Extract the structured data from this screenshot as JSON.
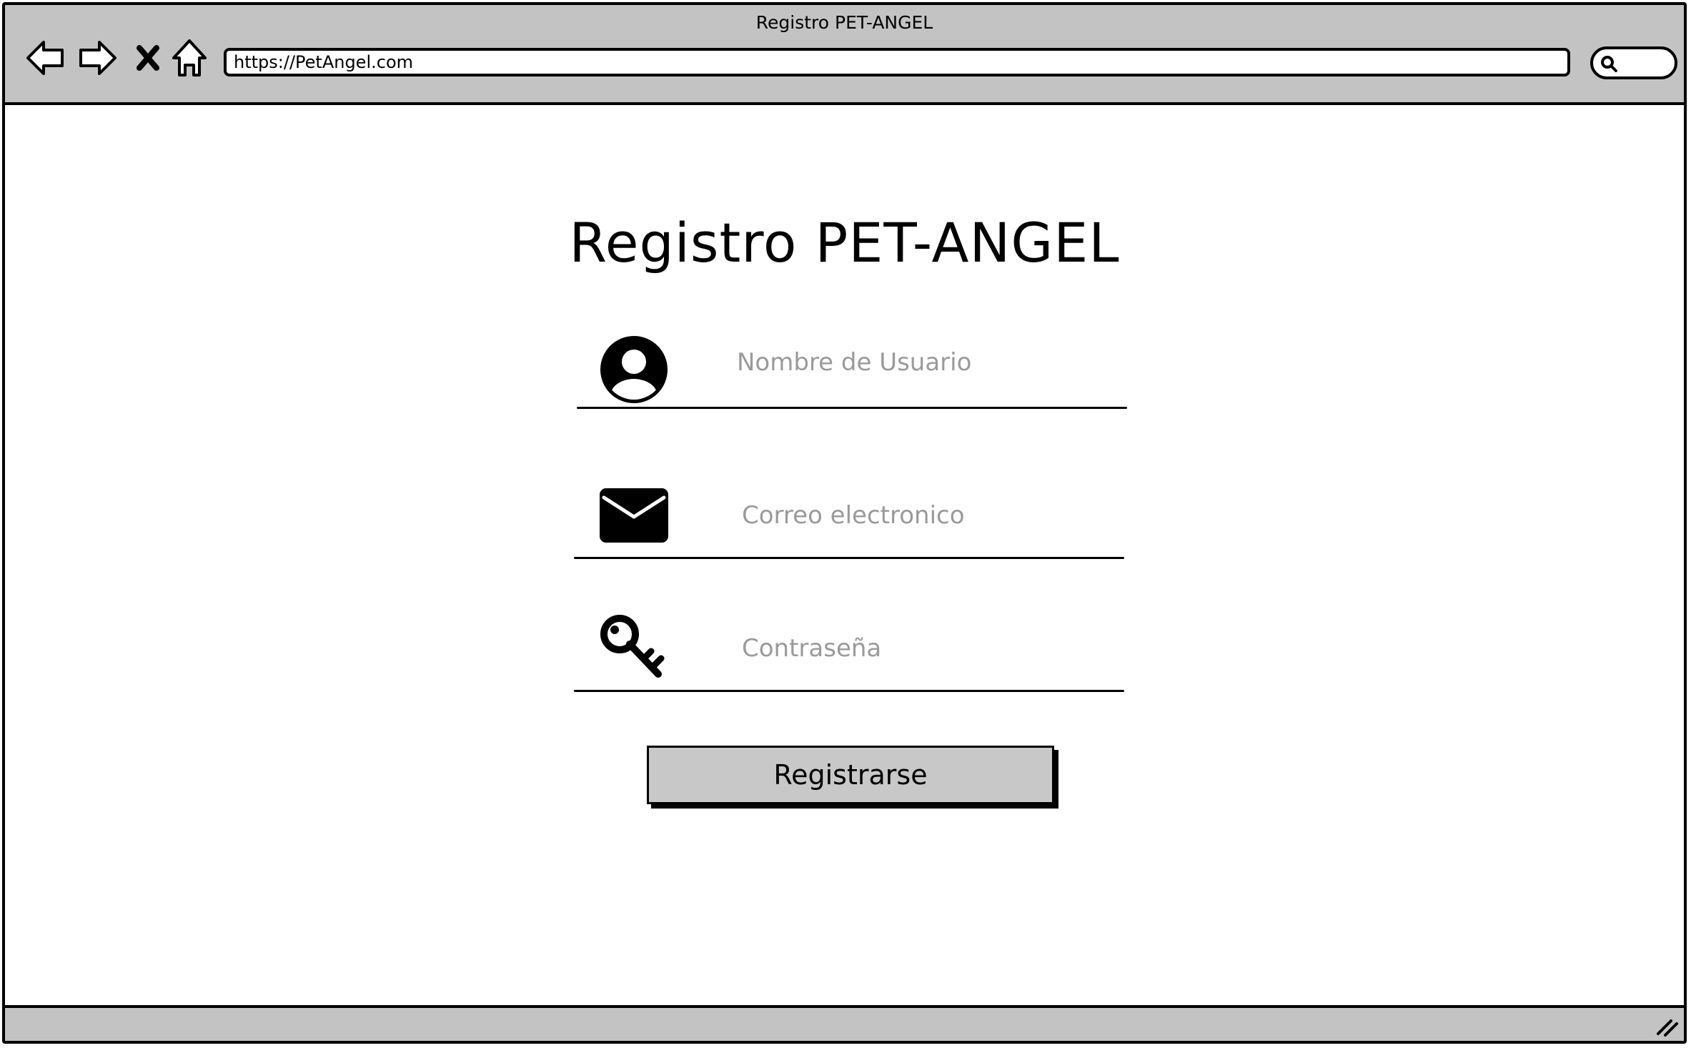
{
  "window": {
    "title": "Registro PET-ANGEL"
  },
  "browser": {
    "url": "https://PetAngel.com",
    "nav_icons": [
      "back-arrow-icon",
      "forward-arrow-icon",
      "stop-icon",
      "home-icon"
    ],
    "search_icon": "search-icon"
  },
  "form": {
    "title": "Registro PET-ANGEL",
    "fields": [
      {
        "icon": "user-avatar-icon",
        "placeholder": "Nombre de Usuario"
      },
      {
        "icon": "envelope-icon",
        "placeholder": "Correo electronico"
      },
      {
        "icon": "key-icon",
        "placeholder": "Contraseña"
      }
    ],
    "submit_label": "Registrarse"
  },
  "colors": {
    "chrome": "#c3c3c3",
    "button": "#c8c8c8",
    "placeholder": "#9a9a9a"
  }
}
